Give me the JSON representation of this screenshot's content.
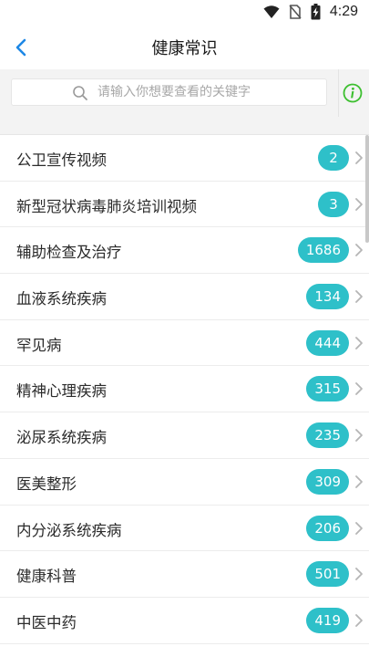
{
  "status_bar": {
    "time": "4:29",
    "icons": [
      "wifi-icon",
      "no-sim-icon",
      "battery-charging-icon"
    ]
  },
  "header": {
    "title": "健康常识",
    "back_icon": "chevron-left-icon"
  },
  "search": {
    "placeholder": "请输入你想要查看的关键字",
    "value": "",
    "info_icon": "info-icon"
  },
  "colors": {
    "accent": "#2ec0c9",
    "back_arrow": "#1e88e5",
    "info_green": "#3cbf2f"
  },
  "categories": [
    {
      "label": "公卫宣传视频",
      "count": "2"
    },
    {
      "label": "新型冠状病毒肺炎培训视频",
      "count": "3"
    },
    {
      "label": "辅助检查及治疗",
      "count": "1686"
    },
    {
      "label": "血液系统疾病",
      "count": "134"
    },
    {
      "label": "罕见病",
      "count": "444"
    },
    {
      "label": "精神心理疾病",
      "count": "315"
    },
    {
      "label": "泌尿系统疾病",
      "count": "235"
    },
    {
      "label": "医美整形",
      "count": "309"
    },
    {
      "label": "内分泌系统疾病",
      "count": "206"
    },
    {
      "label": "健康科普",
      "count": "501"
    },
    {
      "label": "中医中药",
      "count": "419"
    }
  ]
}
